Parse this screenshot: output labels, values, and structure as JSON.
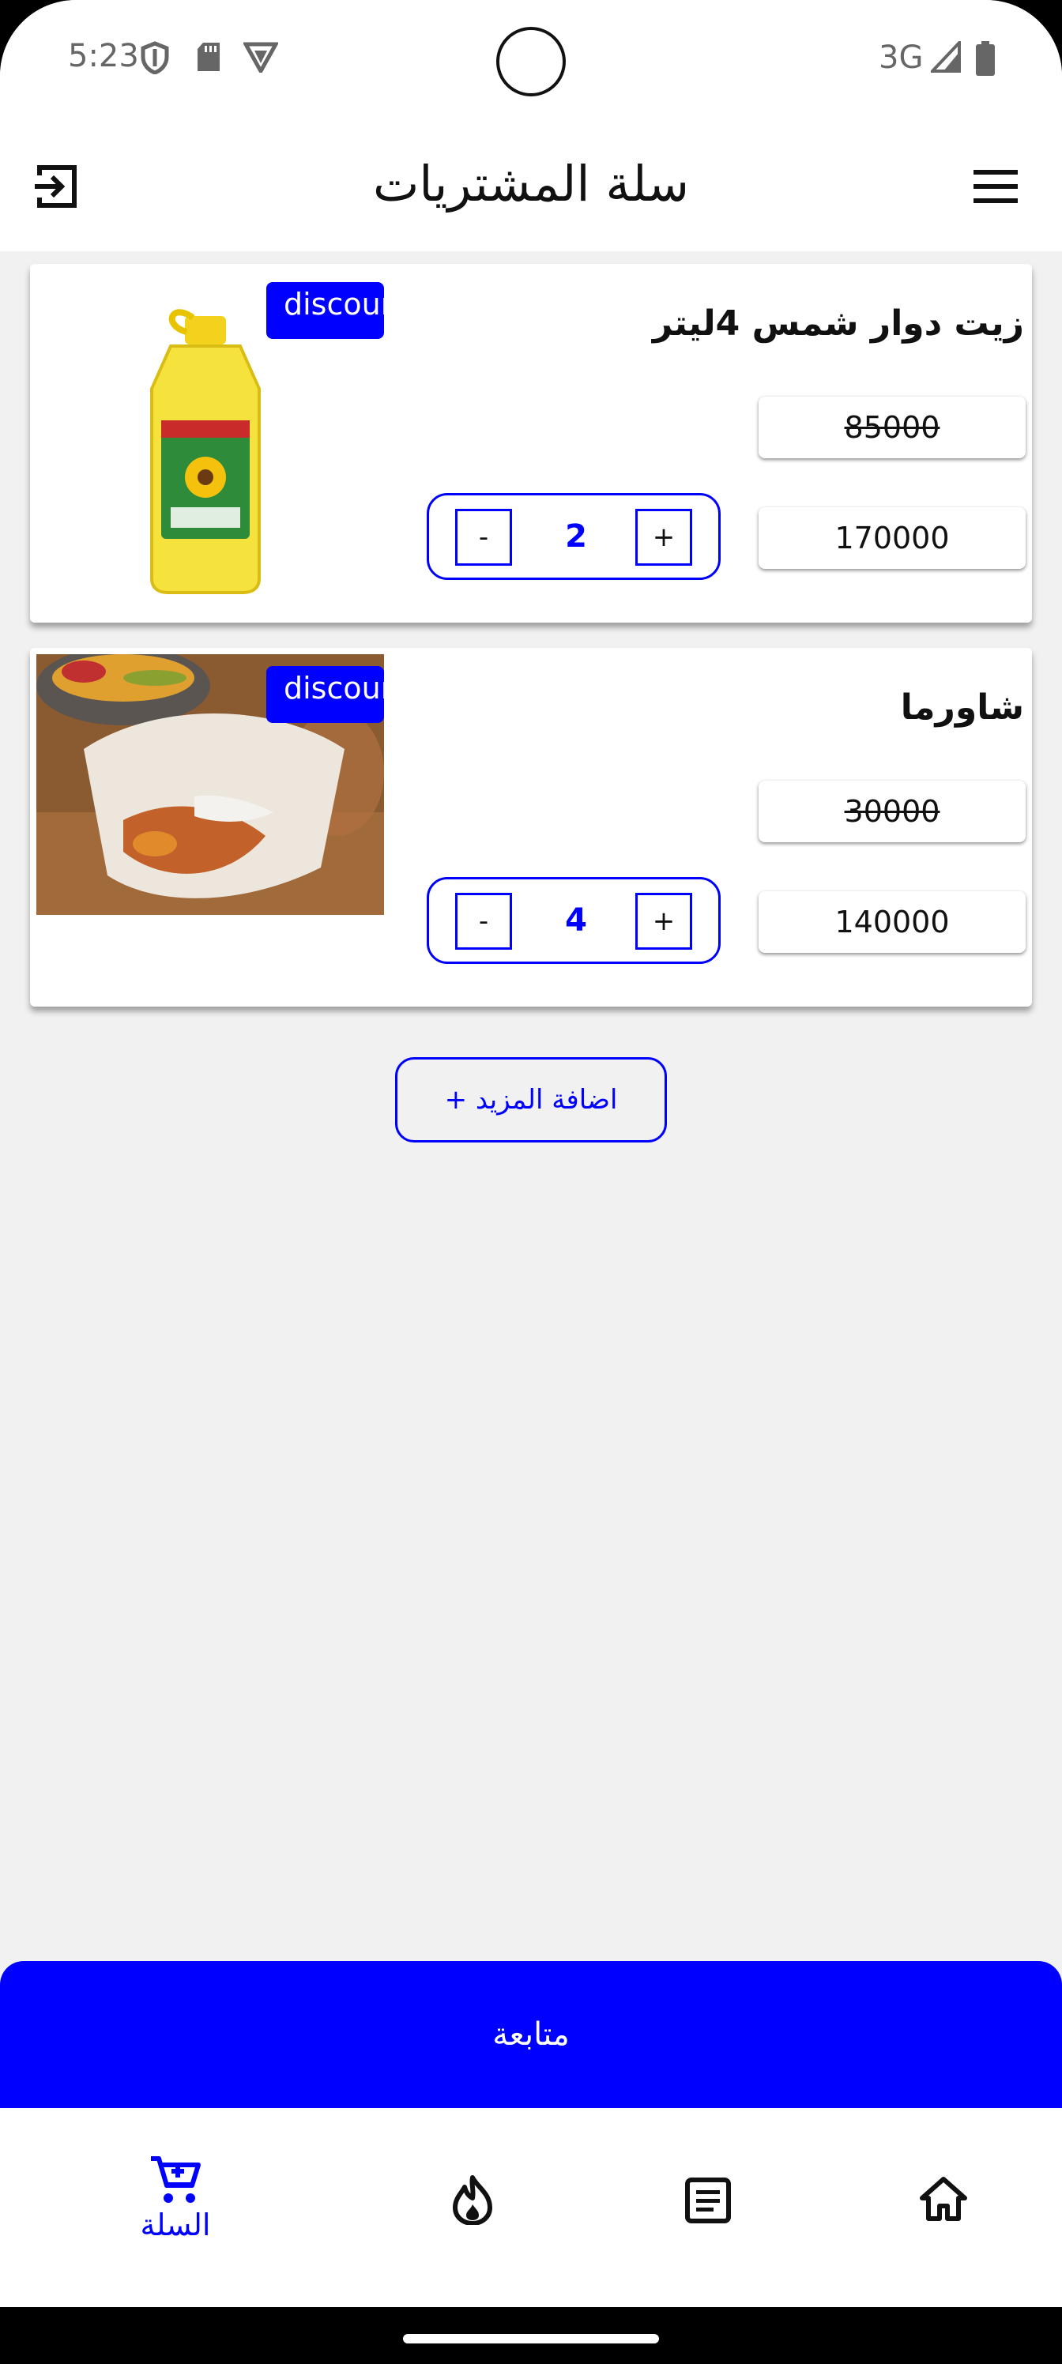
{
  "status_bar": {
    "time": "5:23",
    "network": "3G"
  },
  "app_bar": {
    "title": "سلة المشتريات"
  },
  "cart_items": [
    {
      "name": "زيت دوار شمس 4ليتر",
      "badge": "discount",
      "old_price": "85000",
      "total_price": "170000",
      "quantity": "2",
      "minus_label": "-",
      "plus_label": "+"
    },
    {
      "name": "شاورما",
      "badge": "discount",
      "old_price": "30000",
      "total_price": "140000",
      "quantity": "4",
      "minus_label": "-",
      "plus_label": "+"
    }
  ],
  "add_more_label": "اضافة المزيد +",
  "continue_label": "متابعة",
  "bottom_nav": {
    "cart_label": "السلة",
    "items": [
      "cart-icon",
      "fire-icon",
      "article-icon",
      "home-icon"
    ]
  },
  "colors": {
    "accent": "#0000ff",
    "background": "#f1f1f1"
  }
}
